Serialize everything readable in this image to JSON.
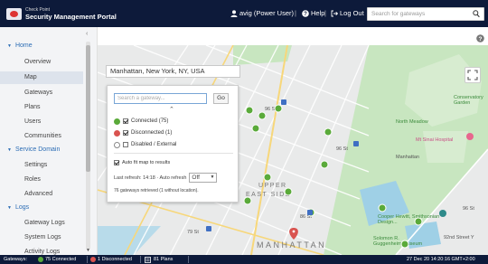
{
  "header": {
    "brand": "Check Point",
    "title": "Security Management Portal",
    "user": "avig (Power User)",
    "help": "Help",
    "logout": "Log Out",
    "search_placeholder": "Search for gateways",
    "separator": "|"
  },
  "sidebar": {
    "sections": [
      {
        "label": "Home",
        "items": [
          "Overview",
          "Map",
          "Gateways",
          "Plans",
          "Users",
          "Communities"
        ]
      },
      {
        "label": "Service Domain",
        "items": [
          "Settings",
          "Roles",
          "Advanced"
        ]
      },
      {
        "label": "Logs",
        "items": [
          "Gateway Logs",
          "System Logs",
          "Activity Logs"
        ]
      }
    ],
    "active_item": "Map"
  },
  "map": {
    "location": "Manhattan, New York, NY, USA",
    "labels": {
      "north_meadow": "North Meadow",
      "conservatory_garden": "Conservatory Garden",
      "mount_sinai": "Mt Sinai Hospital",
      "manhattan_small": "Manhattan",
      "upper_east_side_1": "UPPER",
      "upper_east_side_2": "EAST SIDE",
      "manhattan_big": "MANHATTAN",
      "cooper_hewitt": "Cooper Hewitt, Smithsonian Design...",
      "solomon": "Solomon R. Guggenheim Museum",
      "street_92": "92nd Street Y",
      "street_96_a": "96 St",
      "street_96_b": "96 St",
      "street_96_c": "96 St",
      "street_86": "86 St",
      "street_79": "79 St",
      "street_96_e": "96 St"
    }
  },
  "gateway_panel": {
    "search_placeholder": "Search a gateway...",
    "go_label": "Go",
    "filters": [
      {
        "label": "Connected",
        "count": "(75)",
        "color": "#5aaa3a",
        "checked": true
      },
      {
        "label": "Disconnected",
        "count": "(1)",
        "color": "#d9534f",
        "checked": true
      },
      {
        "label": "Disabled / External",
        "count": "",
        "color": "#ffffff",
        "checked": false
      }
    ],
    "auto_fit": "Auto fit map to results",
    "refresh_label": "Last refresh: 14:18 · Auto refresh",
    "refresh_value": "Off",
    "retrieved": "76 gateways retrieved (1 without location)."
  },
  "footer": {
    "label": "Gateways:",
    "connected": "75 Connected",
    "disconnected": "1 Disconnected",
    "plans": "81 Plans",
    "datetime": "27 Dec 20 14:20:16 GMT+2:00"
  },
  "colors": {
    "header_bg": "#0d1a3a",
    "accent": "#2c6db5",
    "connected": "#5aaa3a",
    "disconnected": "#d9534f"
  }
}
